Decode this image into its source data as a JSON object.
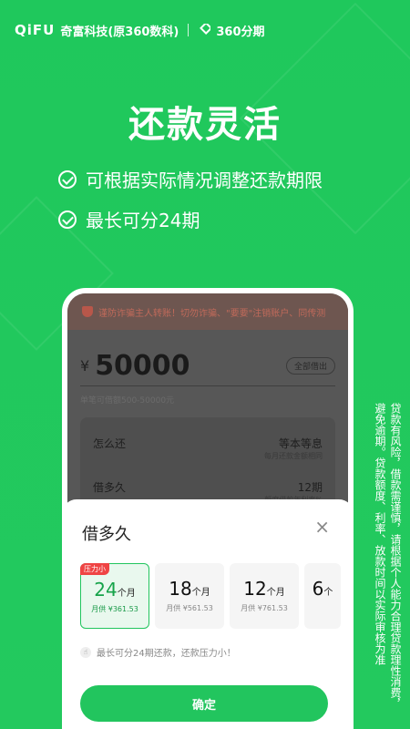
{
  "header": {
    "brand": "QiFU",
    "company": "奇富科技(原360数科)",
    "product": "360分期"
  },
  "headline": "还款灵活",
  "features": [
    "可根据实际情况调整还款期限",
    "最长可分24期"
  ],
  "disclaimer": "贷款有风险，借款需谨慎，请根据个人能力合理贷款理性消费，避免逾期。贷款额度、利率、放款时间以实际审核为准",
  "phone": {
    "notice": "谨防诈骗主人转账！切勿诈骗、\"要要\"注销账户、同传测",
    "currency": "¥",
    "amount": "50000",
    "all_button": "全部借出",
    "range_text": "单笔可借额500-50000元",
    "rows": [
      {
        "label": "怎么还",
        "value": "等本等息",
        "sub": "每月还款金额相同"
      },
      {
        "label": "借多久",
        "value": "12期",
        "sub": "额度借款年利率%"
      }
    ]
  },
  "sheet": {
    "title": "借多久",
    "close": "×",
    "options": [
      {
        "num": "24",
        "unit": "个月",
        "monthly": "月供 ¥361.53",
        "tag": "压力小",
        "selected": true
      },
      {
        "num": "18",
        "unit": "个月",
        "monthly": "月供 ¥561.53",
        "tag": "",
        "selected": false
      },
      {
        "num": "12",
        "unit": "个月",
        "monthly": "月供 ¥761.53",
        "tag": "",
        "selected": false
      },
      {
        "num": "6",
        "unit": "个",
        "monthly": "",
        "tag": "",
        "selected": false
      }
    ],
    "hint": "最长可分24期还款，还款压力小！",
    "confirm": "确定"
  }
}
